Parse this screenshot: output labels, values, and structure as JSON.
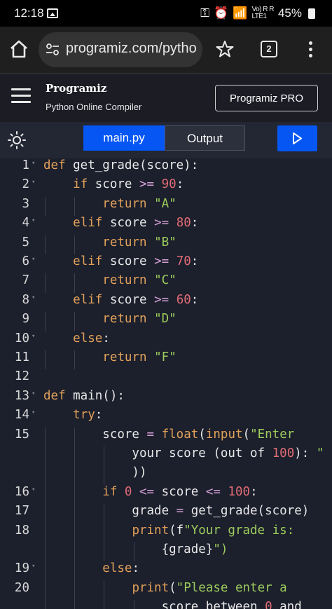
{
  "status_bar": {
    "time": "12:18",
    "signal_text": "Vo) R  R",
    "lte_text": "LTE1",
    "battery": "45%"
  },
  "browser": {
    "url": "programiz.com/pytho",
    "tab_count": "2"
  },
  "site": {
    "logo": "Programiz",
    "subtitle": "Python Online Compiler",
    "pro_button": "Programiz PRO"
  },
  "toolbar": {
    "tab_main": "main.py",
    "tab_output": "Output"
  },
  "editor": {
    "lines": [
      {
        "num": "1",
        "fold": true,
        "text": "def get_grade(score):"
      },
      {
        "num": "2",
        "fold": true,
        "text": "    if score >= 90:"
      },
      {
        "num": "3",
        "fold": false,
        "text": "        return \"A\""
      },
      {
        "num": "4",
        "fold": true,
        "text": "    elif score >= 80:"
      },
      {
        "num": "5",
        "fold": false,
        "text": "        return \"B\""
      },
      {
        "num": "6",
        "fold": true,
        "text": "    elif score >= 70:"
      },
      {
        "num": "7",
        "fold": false,
        "text": "        return \"C\""
      },
      {
        "num": "8",
        "fold": true,
        "text": "    elif score >= 60:"
      },
      {
        "num": "9",
        "fold": false,
        "text": "        return \"D\""
      },
      {
        "num": "10",
        "fold": true,
        "text": "    else:"
      },
      {
        "num": "11",
        "fold": false,
        "text": "        return \"F\""
      },
      {
        "num": "12",
        "fold": false,
        "text": ""
      },
      {
        "num": "13",
        "fold": true,
        "text": "def main():"
      },
      {
        "num": "14",
        "fold": true,
        "text": "    try:"
      },
      {
        "num": "15",
        "fold": false,
        "text": "        score = float(input(\"Enter"
      },
      {
        "num": "",
        "fold": false,
        "text": "            your score (out of 100): \""
      },
      {
        "num": "",
        "fold": false,
        "text": "            ))"
      },
      {
        "num": "16",
        "fold": true,
        "text": "        if 0 <= score <= 100:"
      },
      {
        "num": "17",
        "fold": false,
        "text": "            grade = get_grade(score)"
      },
      {
        "num": "18",
        "fold": false,
        "text": "            print(f\"Your grade is:"
      },
      {
        "num": "",
        "fold": false,
        "text": "                {grade}\")"
      },
      {
        "num": "19",
        "fold": true,
        "text": "        else:"
      },
      {
        "num": "20",
        "fold": false,
        "text": "            print(\"Please enter a"
      },
      {
        "num": "",
        "fold": false,
        "text": "                score between 0 and"
      }
    ]
  },
  "colors": {
    "accent": "#0556f3",
    "keyword": "#e2a25a",
    "string": "#9ccc5c",
    "number": "#e06c75",
    "editor_bg": "#1c1f2c"
  }
}
